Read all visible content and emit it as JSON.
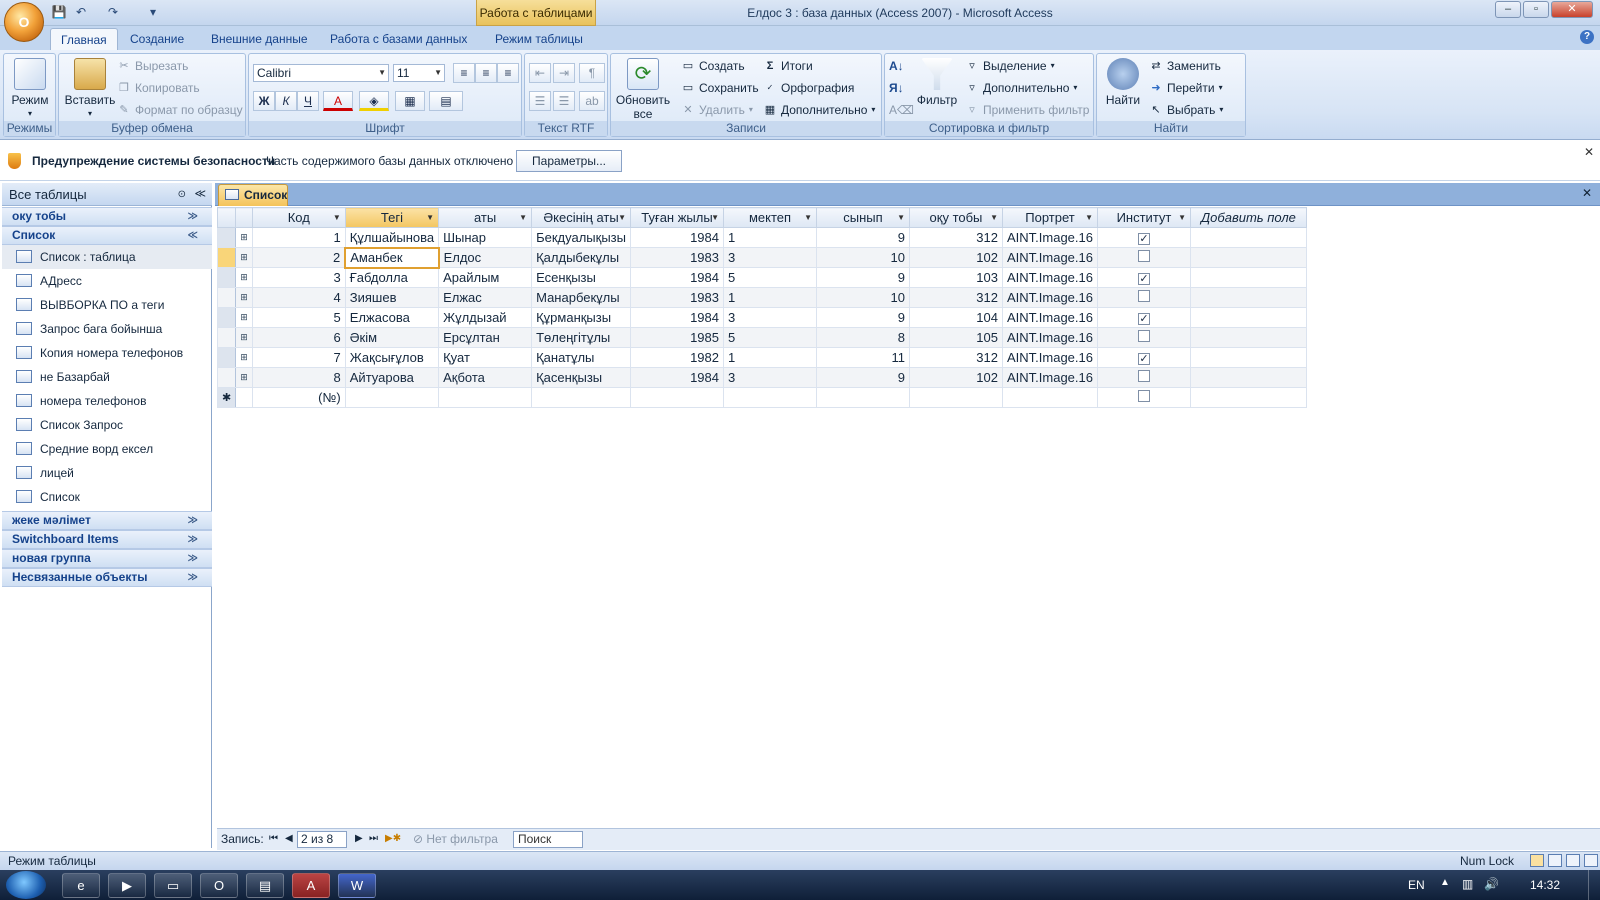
{
  "titlebar": {
    "context_tab": "Работа с таблицами",
    "window_title": "Елдос 3 : база данных (Access 2007) - Microsoft Access",
    "office_label": "O",
    "qat_save": "💾",
    "qat_undo": "↶",
    "qat_redo": "↷",
    "qat_more": "▾",
    "min": "–",
    "max": "▫",
    "close": "✕"
  },
  "ribbon_tabs": [
    "Главная",
    "Создание",
    "Внешние данные",
    "Работа с базами данных",
    "Режим таблицы"
  ],
  "ribbon": {
    "modes": {
      "label": "Режимы",
      "view": "Режим"
    },
    "clipboard": {
      "label": "Буфер обмена",
      "paste": "Вставить",
      "cut": "Вырезать",
      "copy": "Копировать",
      "format": "Формат по образцу"
    },
    "font": {
      "label": "Шрифт",
      "family": "Calibri",
      "size": "11",
      "bold": "Ж",
      "italic": "К",
      "underline": "Ч",
      "color": "A"
    },
    "rtf": {
      "label": "Текст RTF"
    },
    "records": {
      "label": "Записи",
      "refresh": "Обновить все",
      "create": "Создать",
      "save": "Сохранить",
      "delete": "Удалить",
      "totals": "Итоги",
      "spelling": "Орфография",
      "more": "Дополнительно"
    },
    "sort": {
      "label": "Сортировка и фильтр",
      "filter": "Фильтр",
      "selection": "Выделение",
      "advanced": "Дополнительно",
      "apply": "Применить фильтр"
    },
    "find": {
      "label": "Найти",
      "find": "Найти",
      "replace": "Заменить",
      "goto": "Перейти",
      "select": "Выбрать"
    },
    "help": "?"
  },
  "security": {
    "title": "Предупреждение системы безопасности",
    "message": "Часть содержимого базы данных отключено",
    "button": "Параметры...",
    "close": "✕"
  },
  "nav": {
    "header": "Все таблицы",
    "groups_top": [
      {
        "label": "оку тобы"
      },
      {
        "label": "Список"
      }
    ],
    "items": [
      {
        "label": "Список : таблица",
        "selected": true
      },
      {
        "label": "АДресс"
      },
      {
        "label": "ВЫВБОРКА  ПО а теги"
      },
      {
        "label": "Запрос бага бойынша"
      },
      {
        "label": "Копия номера телефонов"
      },
      {
        "label": "не Базарбай"
      },
      {
        "label": "номера телефонов"
      },
      {
        "label": "Список Запрос"
      },
      {
        "label": "Средние ворд ексел"
      },
      {
        "label": "лицей"
      },
      {
        "label": "Список"
      }
    ],
    "groups_bottom": [
      {
        "label": "жеке мәлімет"
      },
      {
        "label": "Switchboard Items"
      },
      {
        "label": "новая группа"
      },
      {
        "label": "Несвязанные объекты"
      }
    ],
    "chev_down": "≫",
    "chev_up": "≪"
  },
  "doc_tab": "Список",
  "doc_close": "✕",
  "table": {
    "columns": [
      "Код",
      "Тегі",
      "аты",
      "Әкесінің аты",
      "Туған жылы",
      "мектеп",
      "сынып",
      "оқу тобы",
      "Портрет",
      "Институт"
    ],
    "add_field": "Добавить поле",
    "rows": [
      {
        "kod": "1",
        "tegi": "Құлшайынова",
        "aty": "Шынар",
        "akesi": "Бекдуалықызы",
        "year": "1984",
        "mektep": "1",
        "synyp": "9",
        "oku": "312",
        "portret": "AINT.Image.16",
        "inst": true
      },
      {
        "kod": "2",
        "tegi": "Аманбек",
        "aty": "Елдос",
        "akesi": "Қалдыбекұлы",
        "year": "1983",
        "mektep": "3",
        "synyp": "10",
        "oku": "102",
        "portret": "AINT.Image.16",
        "inst": false
      },
      {
        "kod": "3",
        "tegi": "Ғабдолла",
        "aty": "Арайлым",
        "akesi": "Есенқызы",
        "year": "1984",
        "mektep": "5",
        "synyp": "9",
        "oku": "103",
        "portret": "AINT.Image.16",
        "inst": true
      },
      {
        "kod": "4",
        "tegi": "Зияшев",
        "aty": "Елжас",
        "akesi": "Манарбекұлы",
        "year": "1983",
        "mektep": "1",
        "synyp": "10",
        "oku": "312",
        "portret": "AINT.Image.16",
        "inst": false
      },
      {
        "kod": "5",
        "tegi": "Елжасова",
        "aty": "Жұлдызай",
        "akesi": "Құрманқызы",
        "year": "1984",
        "mektep": "3",
        "synyp": "9",
        "oku": "104",
        "portret": "AINT.Image.16",
        "inst": true
      },
      {
        "kod": "6",
        "tegi": "Әкім",
        "aty": "Ерсұлтан",
        "akesi": "Төлеңгітұлы",
        "year": "1985",
        "mektep": "5",
        "synyp": "8",
        "oku": "105",
        "portret": "AINT.Image.16",
        "inst": false
      },
      {
        "kod": "7",
        "tegi": "Жақсығұлов",
        "aty": "Қуат",
        "akesi": "Қанатұлы",
        "year": "1982",
        "mektep": "1",
        "synyp": "11",
        "oku": "312",
        "portret": "AINT.Image.16",
        "inst": true
      },
      {
        "kod": "8",
        "tegi": "Айтуарова",
        "aty": "Ақбота",
        "akesi": "Қасенқызы",
        "year": "1984",
        "mektep": "3",
        "synyp": "9",
        "oku": "102",
        "portret": "AINT.Image.16",
        "inst": false
      }
    ],
    "new_row_marker": "✱",
    "new_row_kod": "(№)"
  },
  "recbar": {
    "label": "Запись:",
    "position": "2 из 8",
    "filter": "Нет фильтра",
    "search": "Поиск"
  },
  "statusbar": {
    "left": "Режим таблицы",
    "numlock": "Num Lock"
  },
  "taskbar": {
    "lang": "EN",
    "time": "14:32"
  }
}
